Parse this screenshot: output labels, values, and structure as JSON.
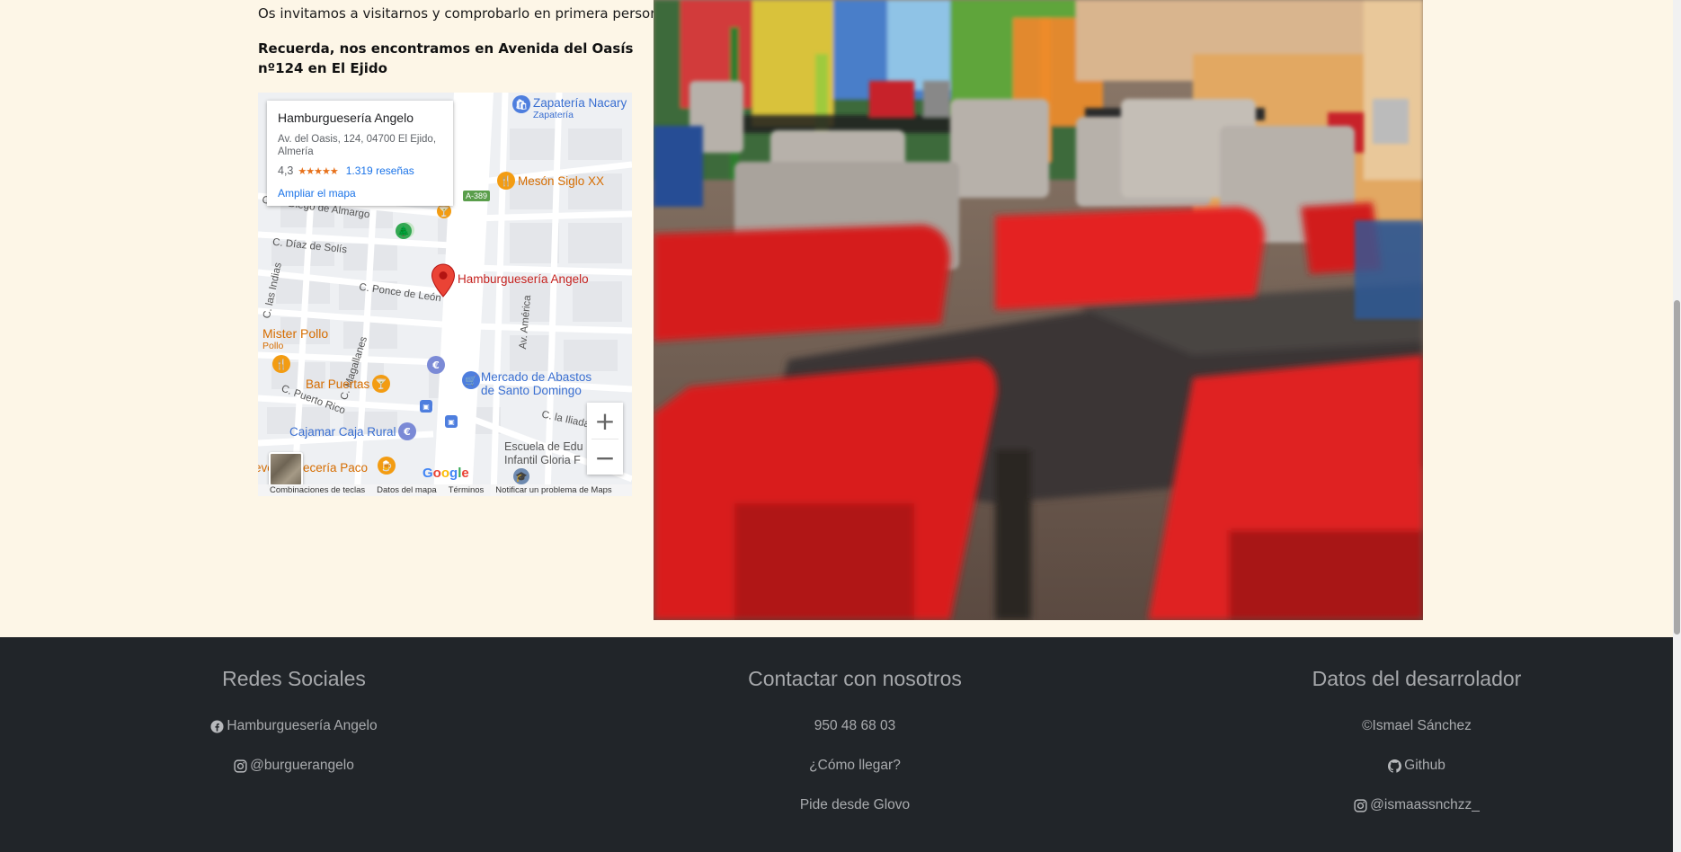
{
  "intro_text": "Os invitamos a visitarnos y comprobarlo en primera persona.",
  "address_text": "Recuerda, nos encontramos en Avenida del Oasís nº124 en El Ejido",
  "map": {
    "place_name": "Hamburguesería Angelo",
    "place_address": "Av. del Oasis, 124, 04700 El Ejido, Almería",
    "rating": "4,3",
    "stars": "★★★★★",
    "reviews": "1.319 reseñas",
    "enlarge_link": "Ampliar el mapa",
    "road_badge": "A-389",
    "pins": {
      "zapateria": "Zapatería Nacary",
      "zapateria_sub": "Zapatería",
      "meson": "Mesón Siglo XX",
      "angelo": "Hamburguesería Angelo",
      "mister_pollo": "Mister Pollo",
      "mister_pollo_sub": "Pollo",
      "bar_puertas": "Bar Puertas",
      "mercado_1": "Mercado de Abastos",
      "mercado_2": "de Santo Domingo",
      "cajamar": "Cajamar Caja Rural",
      "escuela_1": "Escuela de Edu",
      "escuela_2": "Infantil Gloria F",
      "cerveceria": "eve Cervecería Paco"
    },
    "streets": {
      "almargo": "Calle Diego de Almargo",
      "diaz_solis": "C. Díaz de Solís",
      "indias": "C. las Indias",
      "ponce": "C. Ponce de León",
      "magallanes": "C. Magallanes",
      "america": "Av. América",
      "puerto_rico": "C. Puerto Rico",
      "lliada": "C. la Iliada"
    },
    "zoom_in": "+",
    "zoom_out": "−",
    "google": "Google",
    "footer_links": [
      "Combinaciones de teclas",
      "Datos del mapa",
      "Términos",
      "Notificar un problema de Maps"
    ]
  },
  "footer": {
    "social_title": "Redes Sociales",
    "social_facebook": "Hamburguesería Angelo",
    "social_instagram": "@burguerangelo",
    "contact_title": "Contactar con nosotros",
    "contact_phone": "950 48 68 03",
    "contact_directions": "¿Cómo llegar?",
    "contact_glovo": "Pide desde Glovo",
    "dev_title": "Datos del desarrolador",
    "dev_name": "©Ismael Sánchez",
    "dev_github": "Github",
    "dev_instagram": "@ismaassnchzz_"
  },
  "colors": {
    "page_bg": "#fdf6e7",
    "footer_bg": "#212529",
    "footer_text": "#a9abae",
    "map_link": "#1a73e8",
    "map_pin_red": "#ea4335"
  }
}
